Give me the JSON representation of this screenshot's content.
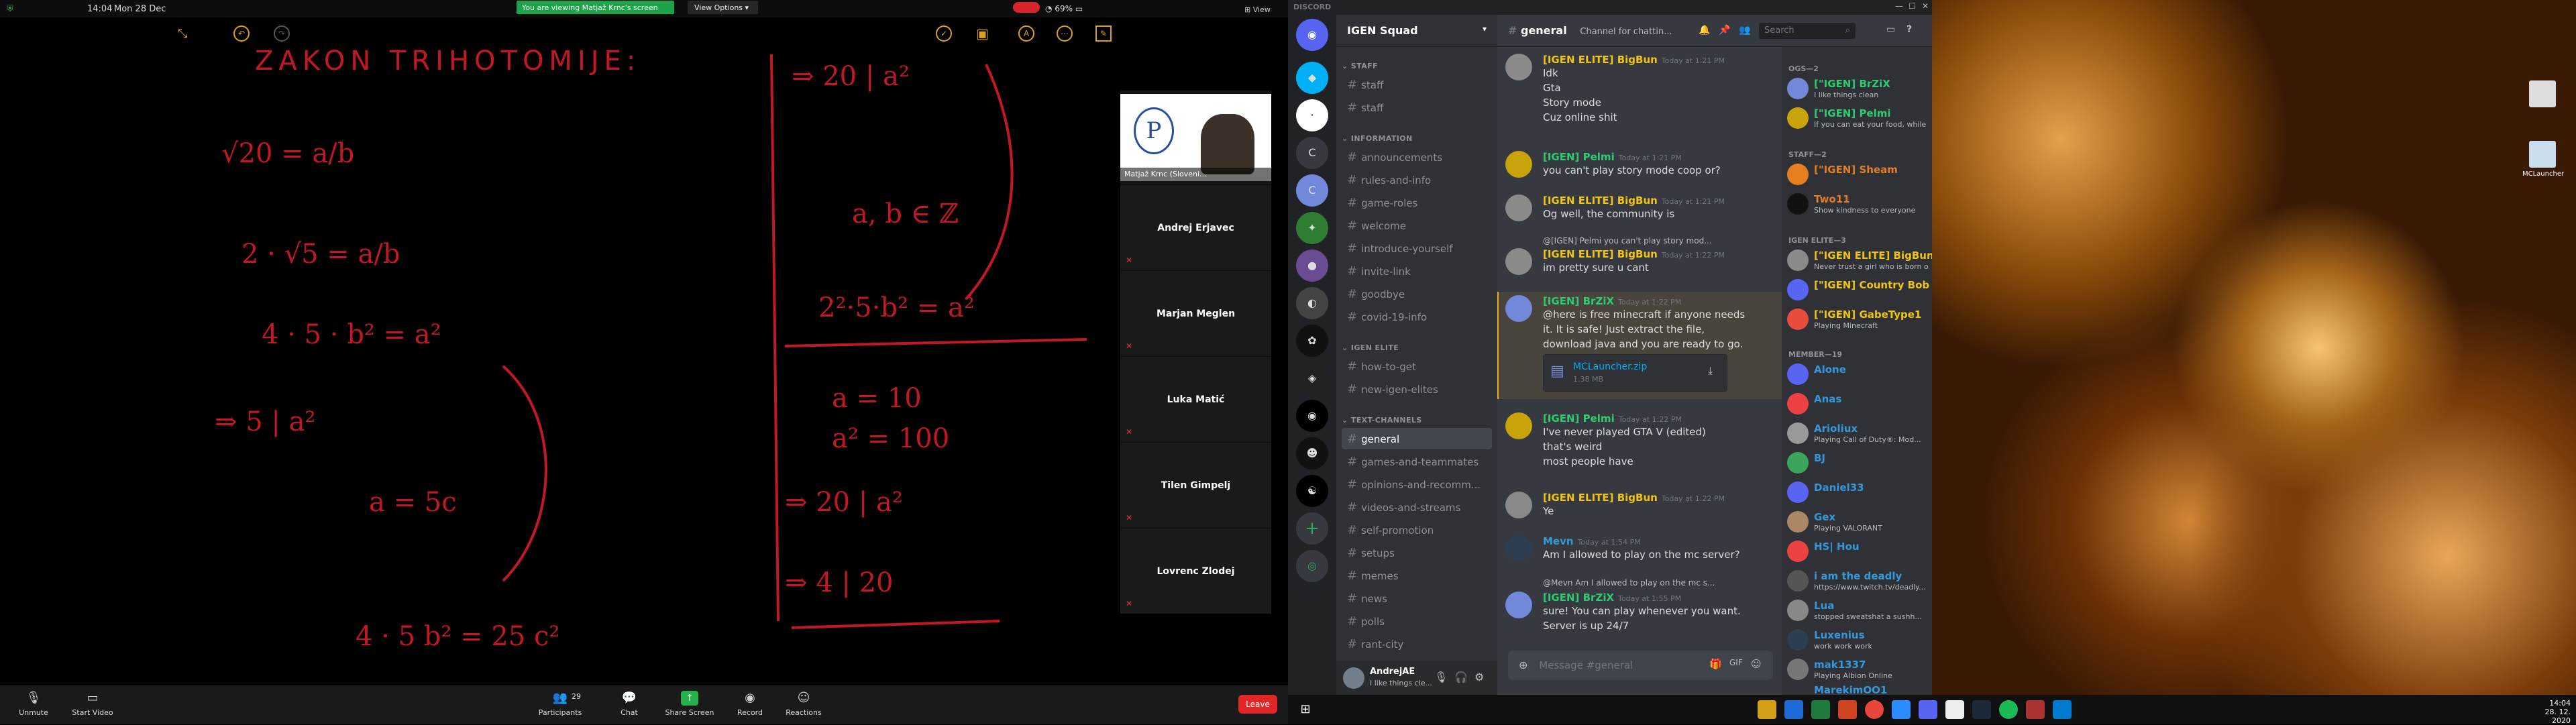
{
  "zoom": {
    "clock": "14:04",
    "date": "Mon 28 Dec",
    "viewing_banner": "You are viewing Matjaž Krnc's screen",
    "view_options": "View Options",
    "battery": "69%",
    "view_label": "View",
    "participants": [
      {
        "name": "Andrej Erjavec"
      },
      {
        "name": "Marjan Meglen"
      },
      {
        "name": "Luka Matić"
      },
      {
        "name": "Tilen Gimpelj"
      },
      {
        "name": "Lovrenc Zlodej"
      }
    ],
    "video_tile_name": "Matjaž Krnc (Sloveni...",
    "toolbar": {
      "unmute": "Unmute",
      "start_video": "Start Video",
      "participants": "Participants",
      "participants_count": "29",
      "chat": "Chat",
      "share_screen": "Share Screen",
      "record": "Record",
      "reactions": "Reactions",
      "leave": "Leave"
    }
  },
  "whiteboard": {
    "title": "ZAKON TRIHOTOMIJE:",
    "left_lines": [
      "√20 = a/b",
      "2 · √5 = a/b",
      "4 · 5 · b² = a²",
      "⇒ 5 | a²",
      "a = 5c",
      "4 · 5 b² = 25 c²"
    ],
    "right_lines": [
      "⇒ 20 | a²",
      "a, b ∈ ℤ",
      "2²·5·b² = a²",
      "a = 10",
      "a² = 100",
      "⇒ 20 | a²",
      "⇒ 4 | 20"
    ]
  },
  "discord": {
    "app_title": "DISCORD",
    "server_name": "IGEN Squad",
    "channel_name": "general",
    "channel_topic": "Channel for chattin...",
    "search_placeholder": "Search",
    "categories": [
      {
        "name": "STAFF",
        "channels": [
          "staff",
          "staff"
        ]
      },
      {
        "name": "INFORMATION",
        "channels": [
          "announcements",
          "rules-and-info",
          "game-roles",
          "welcome",
          "introduce-yourself",
          "invite-link",
          "goodbye",
          "covid-19-info"
        ]
      },
      {
        "name": "IGEN ELITE",
        "channels": [
          "how-to-get",
          "new-igen-elites"
        ]
      },
      {
        "name": "TEXT-CHANNELS",
        "channels": [
          "general",
          "games-and-teammates",
          "opinions-and-recomm...",
          "videos-and-streams",
          "self-promotion",
          "setups",
          "memes",
          "news",
          "polls",
          "rant-city"
        ]
      }
    ],
    "messages": [
      {
        "author": "[IGEN ELITE] BigBun",
        "color": "#f1c40f",
        "time": "Today at 1:21 PM",
        "lines": [
          "Idk",
          "Gta",
          "Story mode",
          "Cuz online shit"
        ]
      },
      {
        "author": "[IGEN] Pelmi",
        "color": "#2ecc71",
        "time": "Today at 1:21 PM",
        "lines": [
          "you can't play story mode coop or?"
        ]
      },
      {
        "author": "[IGEN ELITE] BigBun",
        "color": "#f1c40f",
        "time": "Today at 1:21 PM",
        "lines": [
          "Og well, the community is"
        ]
      },
      {
        "author": "[IGEN ELITE] BigBun",
        "color": "#f1c40f",
        "time": "Today at 1:22 PM",
        "reply": "@[IGEN] Pelmi you can't play story mod...",
        "lines": [
          "im pretty sure u cant"
        ]
      },
      {
        "author": "[IGEN] BrZiX",
        "color": "#2ecc71",
        "time": "Today at 1:22 PM",
        "lines": [
          "@here is free minecraft if anyone needs",
          "it. It is safe! Just extract the file,",
          "download java and you are ready to go."
        ],
        "attachment": "MCLauncher.zip",
        "attachment_size": "1.38 MB"
      },
      {
        "author": "[IGEN] Pelmi",
        "color": "#2ecc71",
        "time": "Today at 1:22 PM",
        "lines": [
          "I've never played GTA V (edited)",
          "that's weird",
          "most people have"
        ]
      },
      {
        "author": "[IGEN ELITE] BigBun",
        "color": "#f1c40f",
        "time": "Today at 1:22 PM",
        "lines": [
          "Ye"
        ]
      },
      {
        "author": "Mevn",
        "color": "#3498db",
        "time": "Today at 1:54 PM",
        "lines": [
          "Am I allowed to play on the mc server?"
        ]
      },
      {
        "author": "[IGEN] BrZiX",
        "color": "#2ecc71",
        "time": "Today at 1:55 PM",
        "reply": "@Mevn Am I allowed to play on the mc s...",
        "lines": [
          "sure! You can play whenever you want.",
          "Server is up 24/7"
        ]
      }
    ],
    "composer_placeholder": "Message #general",
    "user": {
      "name": "AndrejAE",
      "status": "I like things cle..."
    },
    "member_groups": [
      {
        "label": "OGS—2",
        "members": [
          {
            "name": "[\"IGEN] BrZiX",
            "status": "I like things clean",
            "color": "#2ecc71"
          },
          {
            "name": "[\"IGEN] Pelmi",
            "status": "If you can eat your food, while ...",
            "color": "#2ecc71"
          }
        ]
      },
      {
        "label": "STAFF—2",
        "members": [
          {
            "name": "[\"IGEN] Sheam",
            "status": "",
            "color": "#e67e22"
          },
          {
            "name": "Two11",
            "status": "Show kindness to everyone",
            "color": "#e67e22"
          }
        ]
      },
      {
        "label": "IGEN ELITE—3",
        "members": [
          {
            "name": "[\"IGEN ELITE] BigBun",
            "status": "Never trust a girl who is born o...",
            "color": "#f1c40f"
          },
          {
            "name": "[\"IGEN] Country Bob",
            "status": "",
            "color": "#f1c40f"
          },
          {
            "name": "[\"IGEN] GabeType1",
            "status": "Playing Minecraft",
            "color": "#f1c40f"
          }
        ]
      },
      {
        "label": "MEMBER—19",
        "members": [
          {
            "name": "Alone",
            "status": "",
            "color": "#3498db"
          },
          {
            "name": "Anas",
            "status": "",
            "color": "#3498db"
          },
          {
            "name": "Arioliux",
            "status": "Playing Call of Duty®: Mod...",
            "color": "#3498db"
          },
          {
            "name": "BJ",
            "status": "",
            "color": "#3498db"
          },
          {
            "name": "Daniel33",
            "status": "",
            "color": "#3498db"
          },
          {
            "name": "Gex",
            "status": "Playing VALORANT",
            "color": "#3498db"
          },
          {
            "name": "HS| Hou",
            "status": "",
            "color": "#3498db"
          },
          {
            "name": "i am the deadly",
            "status": "https://www.twitch.tv/deadly...",
            "color": "#3498db"
          },
          {
            "name": "Lua",
            "status": "stopped sweatshat a sushh...",
            "color": "#3498db"
          },
          {
            "name": "Luxenius",
            "status": "work work work",
            "color": "#3498db"
          },
          {
            "name": "mak1337",
            "status": "Playing Albion Online",
            "color": "#3498db"
          },
          {
            "name": "MarekimOO1",
            "status": "",
            "color": "#3498db"
          }
        ]
      }
    ]
  },
  "desktop": {
    "icon_label": "MCLauncher",
    "clock_time": "14:04",
    "clock_date": "28. 12. 2020"
  }
}
